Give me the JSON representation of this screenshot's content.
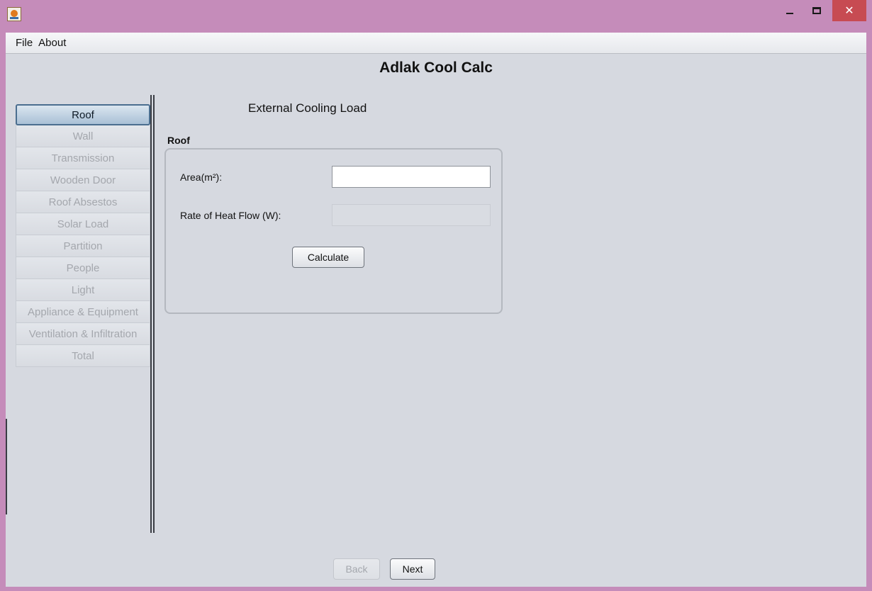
{
  "window": {
    "title": "",
    "controls": {
      "minimize": "minimize-icon",
      "maximize": "maximize-icon",
      "close": "close-icon"
    },
    "title_bar_color": "#c58cba",
    "close_color": "#c74b52"
  },
  "menu": {
    "items": [
      "File",
      "About"
    ]
  },
  "app": {
    "title": "Adlak Cool Calc"
  },
  "sidebar": {
    "items": [
      {
        "label": "Roof",
        "active": true
      },
      {
        "label": "Wall"
      },
      {
        "label": "Transmission"
      },
      {
        "label": "Wooden Door"
      },
      {
        "label": "Roof Absestos"
      },
      {
        "label": "Solar Load"
      },
      {
        "label": "Partition"
      },
      {
        "label": "People"
      },
      {
        "label": "Light"
      },
      {
        "label": "Appliance & Equipment"
      },
      {
        "label": "Ventilation & Infiltration"
      },
      {
        "label": "Total"
      }
    ]
  },
  "main": {
    "section_title": "External Cooling Load",
    "group_label": "Roof",
    "area_label": "Area(m²):",
    "area_value": "",
    "rate_label": "Rate of Heat Flow (W):",
    "rate_value": "",
    "calculate_label": "Calculate"
  },
  "nav": {
    "back_label": "Back",
    "next_label": "Next"
  }
}
